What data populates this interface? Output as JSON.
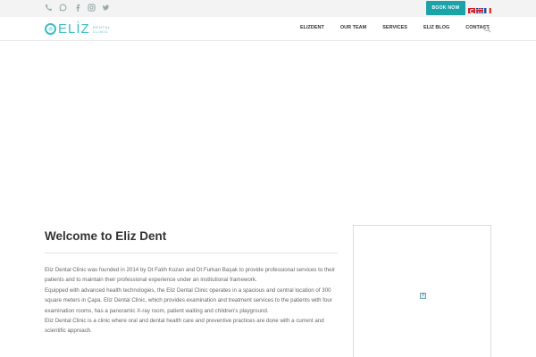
{
  "topbar": {
    "social_icons": [
      "phone-icon",
      "whatsapp-icon",
      "facebook-icon",
      "instagram-icon",
      "twitter-icon"
    ],
    "book_label": "BOOK NOW",
    "languages": [
      "Türkçe",
      "English",
      "Français"
    ]
  },
  "header": {
    "logo_word": "ELİZ",
    "logo_sub_top": "DENTAL",
    "logo_sub_bottom": "CLINIC",
    "menu": [
      "ELIZDENT",
      "OUR TEAM",
      "SERVICES",
      "ELIZ BLOG",
      "CONTACT"
    ]
  },
  "welcome": {
    "title_pre": "Welcome to",
    "title_main": "Eliz Dent",
    "paragraphs": [
      "Eliz Dental Clinic was founded in 2014 by Dt Fatih Kozan and Dt Furkan Başak to provide professional services to their patients and to maintain their professional experience under an institutional framework.",
      "Equipped with advanced health technologies, the Eliz Dental Clinic operates in a spacious and central location of 300 square meters in Çapa. Eliz Dental Clinic, which provides examination and treatment services to the patients with four examination rooms, has a panoramic X-ray room, patient waiting and children's playground.",
      "Eliz Dental Clinic is a clinic where oral and dental health care and preventive practices are done with a current and scientific approach."
    ]
  },
  "side_box": {
    "missing_image_mark": "?"
  },
  "colors": {
    "accent": "#1aa3a8",
    "logo": "#3dbdc1"
  }
}
